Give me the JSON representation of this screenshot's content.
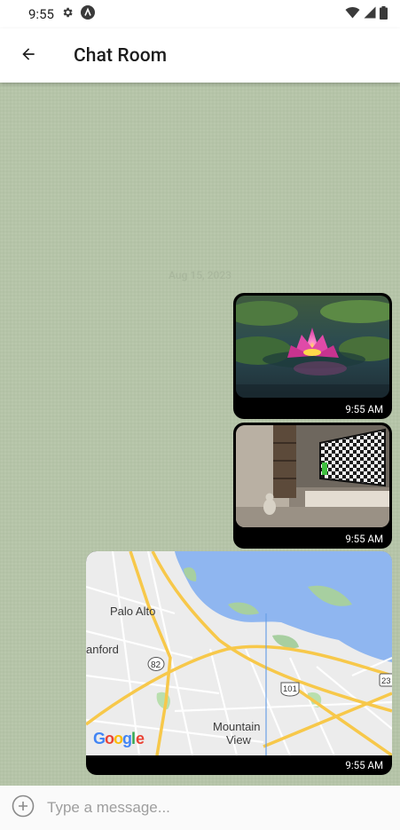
{
  "status_bar": {
    "time": "9:55",
    "icons": [
      "gear-icon",
      "a-circle-icon",
      "wifi-icon",
      "cellular-icon",
      "battery-icon"
    ]
  },
  "app_bar": {
    "back_icon": "arrow-left-icon",
    "title": "Chat Room"
  },
  "chat": {
    "background_color": "#b5c4a8",
    "date_separator": "Aug 15, 2023",
    "messages": [
      {
        "type": "image",
        "content": "pink water lily on lily pads",
        "time": "9:55 AM"
      },
      {
        "type": "video",
        "content": "room with bookshelf, cat and tv showing checkerboard",
        "time": "9:55 AM"
      },
      {
        "type": "map",
        "time": "9:55 AM",
        "map_labels": {
          "city1": "Palo Alto",
          "city2": "anford",
          "city3_line1": "Mountain",
          "city3_line2": "View",
          "shield_82": "82",
          "shield_101": "101",
          "shield_23": "23",
          "brand": "Google"
        }
      }
    ]
  },
  "input": {
    "placeholder": "Type a message...",
    "value": ""
  },
  "colors": {
    "bubble": "#000000",
    "map_water": "#8fb6f0",
    "map_land": "#ececec",
    "map_road": "#f7c84a"
  }
}
